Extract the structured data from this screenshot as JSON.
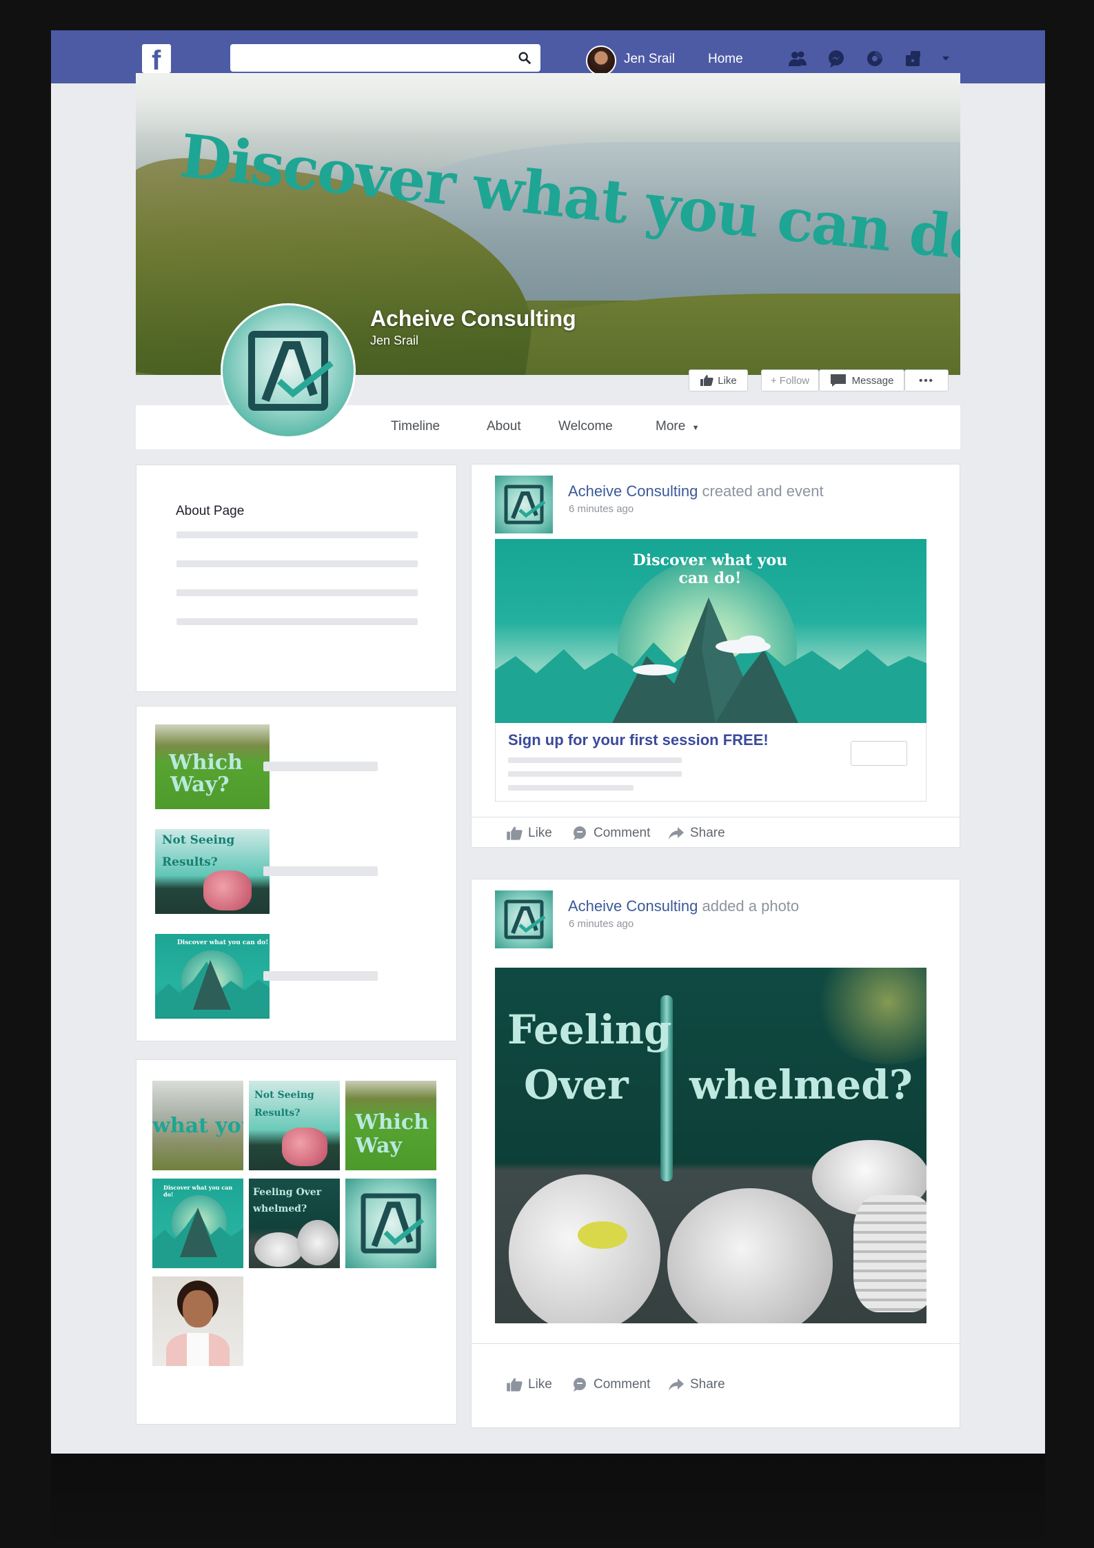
{
  "topbar": {
    "logo_letter": "f",
    "search_placeholder": "",
    "user_name": "Jen Srail",
    "home_label": "Home",
    "icons": [
      "friends-icon",
      "messenger-icon",
      "notifications-icon",
      "help-icon",
      "dropdown-icon"
    ]
  },
  "cover": {
    "headline": "Discover what you can do!",
    "page_name": "Acheive Consulting",
    "page_subtitle": "Jen Srail",
    "buttons": {
      "like": "Like",
      "follow": "+ Follow",
      "message": "Message",
      "more": "•••"
    }
  },
  "nav": {
    "tabs": [
      "Timeline",
      "About",
      "Welcome",
      "More"
    ]
  },
  "about_card": {
    "title": "About Page"
  },
  "event_post": {
    "author": "Acheive Consulting",
    "action_text": "created and event",
    "time": "6 minutes ago",
    "image_text": "Discover what you can do!",
    "event_title": "Sign up for your first session FREE!"
  },
  "photo_post": {
    "author": "Acheive Consulting",
    "action_text": "added a photo",
    "time": "6 minutes ago",
    "image_line1": "Feeling",
    "image_line2a": "Over",
    "image_line2b": "whelmed?"
  },
  "post_actions": {
    "like": "Like",
    "comment": "Comment",
    "share": "Share"
  },
  "side_posts": [
    {
      "thumb_text_a": "Which",
      "thumb_text_b": "Way?"
    },
    {
      "thumb_text_a": "Not Seeing",
      "thumb_text_b": "Results?"
    },
    {
      "thumb_text_a": "Discover what you can do!",
      "thumb_text_b": ""
    }
  ],
  "photo_grid": {
    "tiles": [
      "what you c",
      "Not Seeing Results?",
      "Which Way",
      "Discover what you can do!",
      "Feeling Over whelmed?",
      "A",
      ""
    ]
  },
  "colors": {
    "brand_blue": "#4d5ba5",
    "teal": "#1ea593",
    "link": "#3b5998",
    "bg": "#e9ebee"
  }
}
